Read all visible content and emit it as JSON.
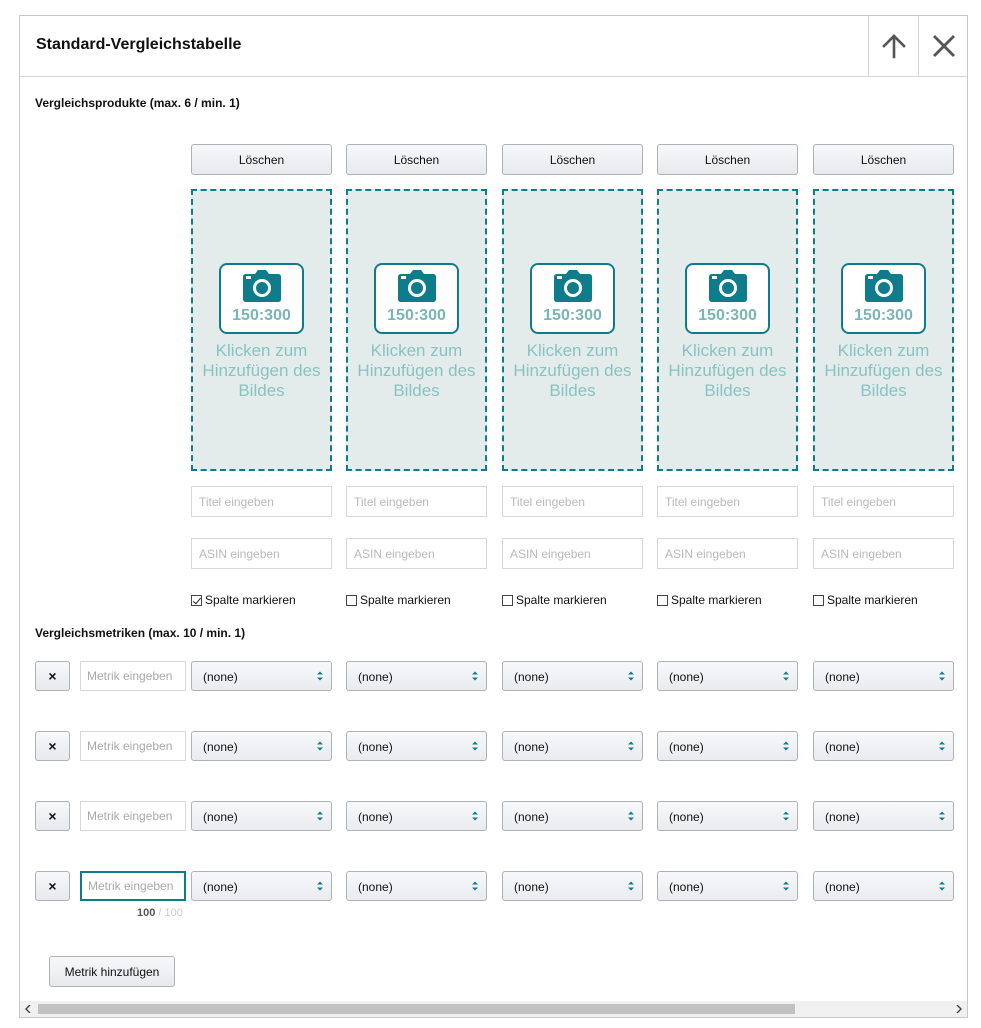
{
  "dialog": {
    "title": "Standard-Vergleichstabelle",
    "move_up_icon": "arrow-up-icon",
    "close_icon": "close-icon"
  },
  "products_section": {
    "label": "Vergleichsprodukte (max. 6 / min. 1)",
    "delete_label": "Löschen",
    "image_ratio": "150:300",
    "image_caption": "Klicken zum Hinzufügen des Bildes",
    "title_placeholder": "Titel eingeben",
    "asin_placeholder": "ASIN eingeben",
    "highlight_label": "Spalte markieren",
    "columns": [
      {
        "highlighted": true
      },
      {
        "highlighted": false
      },
      {
        "highlighted": false
      },
      {
        "highlighted": false
      },
      {
        "highlighted": false
      }
    ]
  },
  "metrics_section": {
    "label": "Vergleichsmetriken (max. 10 / min. 1)",
    "remove_label": "×",
    "metric_placeholder": "Metrik eingeben",
    "select_value": "(none)",
    "rows": [
      {
        "focused": false
      },
      {
        "focused": false
      },
      {
        "focused": false
      },
      {
        "focused": true
      }
    ],
    "counter": {
      "current": "100",
      "separator": "/",
      "max": "100"
    },
    "add_button_label": "Metrik hinzufügen"
  },
  "colors": {
    "accent": "#0f7c8c",
    "image_placeholder_bg": "#e4eceb",
    "image_caption": "#86c4c1"
  }
}
